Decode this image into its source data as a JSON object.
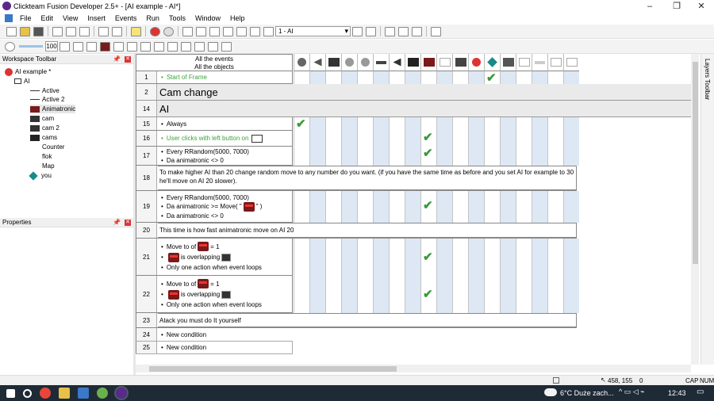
{
  "window": {
    "title": "Clickteam Fusion Developer 2.5+ - [AI example - AI*]"
  },
  "menu": [
    "File",
    "Edit",
    "View",
    "Insert",
    "Events",
    "Run",
    "Tools",
    "Window",
    "Help"
  ],
  "toolbar": {
    "frame_select": "1 - AI",
    "zoom_value": "100"
  },
  "workspace": {
    "title": "Workspace Toolbar",
    "items": [
      {
        "label": "AI example *",
        "icon": "app-icon"
      },
      {
        "label": "AI",
        "icon": "frame-icon"
      },
      {
        "label": "Active",
        "icon": "line-icon"
      },
      {
        "label": "Active 2",
        "icon": "line-icon"
      },
      {
        "label": "Animatronic",
        "icon": "animatronic-icon"
      },
      {
        "label": "cam",
        "icon": "cam-icon"
      },
      {
        "label": "cam 2",
        "icon": "cam-icon"
      },
      {
        "label": "cams",
        "icon": "cam-icon"
      },
      {
        "label": "Counter",
        "icon": "counter-icon"
      },
      {
        "label": "flok",
        "icon": "counter-icon"
      },
      {
        "label": "Map",
        "icon": "counter-icon"
      },
      {
        "label": "you",
        "icon": "diamond-icon"
      }
    ]
  },
  "properties": {
    "title": "Properties"
  },
  "editor": {
    "header_line1": "All the events",
    "header_line2": "All the objects",
    "rows": [
      {
        "num": "1",
        "conds": [
          "Start of Frame"
        ]
      },
      {
        "num": "2",
        "group": "Cam change"
      },
      {
        "num": "14",
        "group": "AI"
      },
      {
        "num": "15",
        "conds": [
          "Always"
        ]
      },
      {
        "num": "16",
        "conds": [
          "User clicks with left button on"
        ]
      },
      {
        "num": "17",
        "conds": [
          "Every RRandom(5000, 7000)",
          "Da animatronic <> 0"
        ]
      },
      {
        "num": "18",
        "comment": "To make higher AI than 20 change random move to any number do you want. (if you have the same time as before and you set AI for example to 30 he'll move on AI 20 slower)."
      },
      {
        "num": "19",
        "conds": [
          "Every RRandom(5000, 7000)",
          "Da animatronic >= Move( \"",
          "\" )",
          "Da animatronic <> 0"
        ]
      },
      {
        "num": "20",
        "comment": "This time is how fast animatronic move on AI 20"
      },
      {
        "num": "21",
        "conds": [
          "Move to of",
          "= 1",
          "is overlapping",
          "Only one action when event loops"
        ]
      },
      {
        "num": "22",
        "conds": [
          "Move to of",
          "= 1",
          "is overlapping",
          "Only one action when event loops"
        ]
      },
      {
        "num": "23",
        "comment": "Atack you must do It yourself"
      },
      {
        "num": "24",
        "conds": [
          "New condition"
        ]
      },
      {
        "num": "25",
        "conds": [
          "New condition"
        ]
      }
    ]
  },
  "layers": {
    "title": "Layers Toolbar"
  },
  "status": {
    "coords": "458, 155",
    "zero": "0",
    "cap": "CAP",
    "num": "NUM"
  },
  "taskbar": {
    "weather": "6°C  Duże zach...",
    "time": "12:43"
  },
  "colors": {
    "check": "#3a9a3a",
    "condition_green": "#3aa33a",
    "taskbar": "#1e2a36"
  }
}
